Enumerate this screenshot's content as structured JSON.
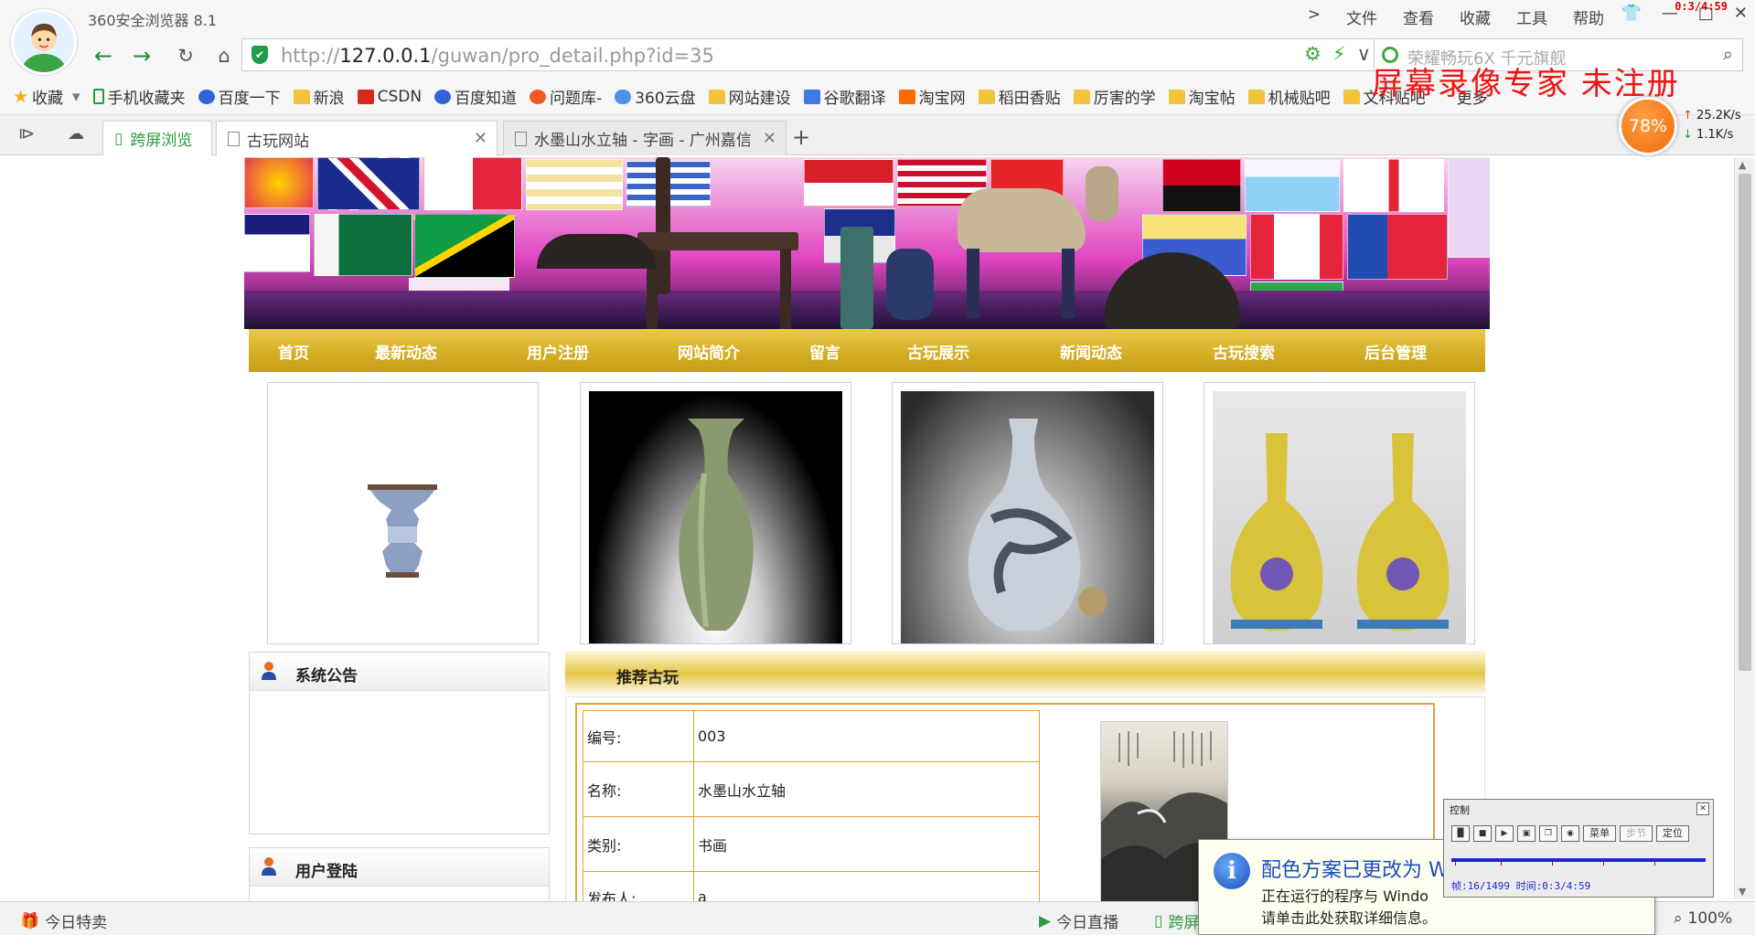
{
  "browser": {
    "app_title": "360安全浏览器 8.1",
    "menu": [
      "文件",
      "查看",
      "收藏",
      "工具",
      "帮助"
    ],
    "menu_chevron": ">",
    "timer": "0:3/4:59",
    "url_prefix": "http://",
    "url_host": "127.0.0.1",
    "url_path": "/guwan/pro_detail.php?id=35",
    "search_placeholder": "荣耀畅玩6X 千元旗舰",
    "bookmarks": [
      {
        "label": "收藏",
        "icon": "star"
      },
      {
        "label": "手机收藏夹",
        "icon": "phone"
      },
      {
        "label": "百度一下",
        "icon": "paw"
      },
      {
        "label": "新浪",
        "icon": "folder"
      },
      {
        "label": "CSDN",
        "icon": "csdn"
      },
      {
        "label": "百度知道",
        "icon": "paw"
      },
      {
        "label": "问题库-",
        "icon": "s"
      },
      {
        "label": "360云盘",
        "icon": "cloud"
      },
      {
        "label": "网站建设",
        "icon": "folder"
      },
      {
        "label": "谷歌翻译",
        "icon": "tr"
      },
      {
        "label": "淘宝网",
        "icon": "tb"
      },
      {
        "label": "稻田香贴",
        "icon": "folder"
      },
      {
        "label": "厉害的学",
        "icon": "folder"
      },
      {
        "label": "淘宝帖",
        "icon": "folder"
      },
      {
        "label": "机械贴吧",
        "icon": "folder"
      },
      {
        "label": "文科贴吧",
        "icon": "folder"
      }
    ],
    "bookmarks_more": "更多",
    "watermark": "屏幕录像专家  未注册",
    "tabs": {
      "split_view": "跨屏浏览",
      "active": "古玩网站",
      "second": "水墨山水立轴 - 字画 - 广州嘉信"
    },
    "speed": {
      "percent": "78%",
      "up": "25.2K/s",
      "down": "1.1K/s"
    }
  },
  "site": {
    "nav": [
      "首页",
      "最新动态",
      "用户注册",
      "网站简介",
      "留言",
      "古玩展示",
      "新闻动态",
      "古玩搜索",
      "后台管理"
    ],
    "panels": {
      "notice_title": "系统公告",
      "login_title": "用户登陆"
    },
    "recommend_title": "推荐古玩",
    "detail": [
      {
        "label": "编号:",
        "value": "003"
      },
      {
        "label": "名称:",
        "value": "水墨山水立轴"
      },
      {
        "label": "类别:",
        "value": "书画"
      },
      {
        "label": "发布人:",
        "value": "a"
      }
    ]
  },
  "statusbar": {
    "today_deals": "今日特卖",
    "today_live": "今日直播",
    "cross_screen": "跨屏",
    "zoom": "100%"
  },
  "balloon": {
    "title": "配色方案已更改为 W",
    "line1": "正在运行的程序与 Windo",
    "line2": "请单击此处获取详细信息。"
  },
  "recorder": {
    "title": "控制",
    "menu_btn": "菜单",
    "step_btn": "步节",
    "locate_btn": "定位",
    "status": "帧:16/1499 时间:0:3/4:59"
  },
  "colors": {
    "nav_gold": "#d3ac22",
    "browser_green": "#1d8a3e",
    "table_border": "#e2a23a",
    "watermark_red": "#ef1313"
  }
}
